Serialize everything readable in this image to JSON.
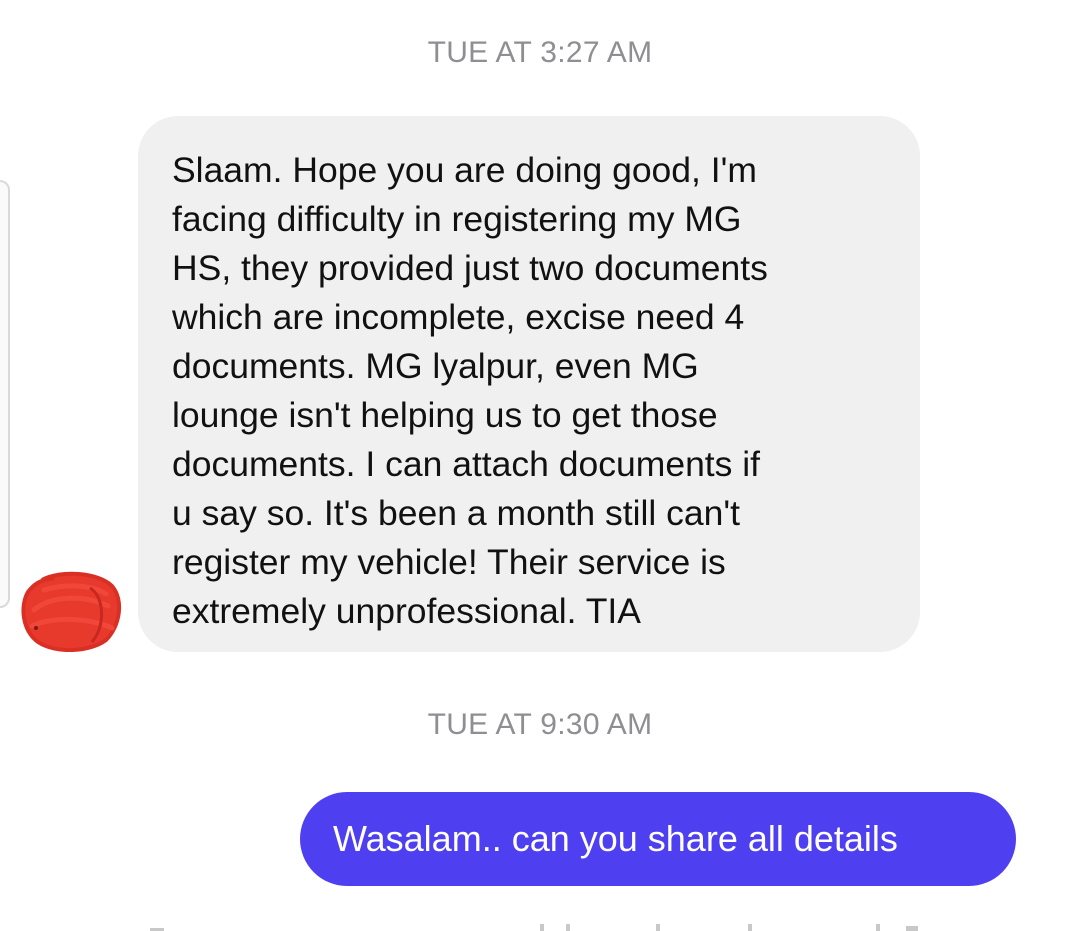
{
  "conversation": {
    "timestamps": [
      "TUE AT 3:27 AM",
      "TUE AT 9:30 AM"
    ],
    "incoming_message": {
      "lines": [
        "Slaam. Hope you are doing good, I'm",
        "facing difficulty in registering my MG",
        "HS, they provided just two documents",
        "which are incomplete, excise need 4",
        "documents. MG lyalpur, even MG",
        "lounge isn't helping us to get those",
        "documents. I can attach documents if",
        "u say so. It's been a month still can't",
        "register my vehicle! Their service is",
        "extremely unprofessional. TIA"
      ]
    },
    "outgoing_message": {
      "text": "Wasalam.. can you share all details"
    },
    "avatar": {
      "redacted": true,
      "scribble_color": "#e8392d"
    },
    "colors": {
      "incoming_bubble": "#f1f0f0",
      "outgoing_bubble": "#4e3ff0",
      "timestamp_text": "#8e8e93"
    }
  }
}
